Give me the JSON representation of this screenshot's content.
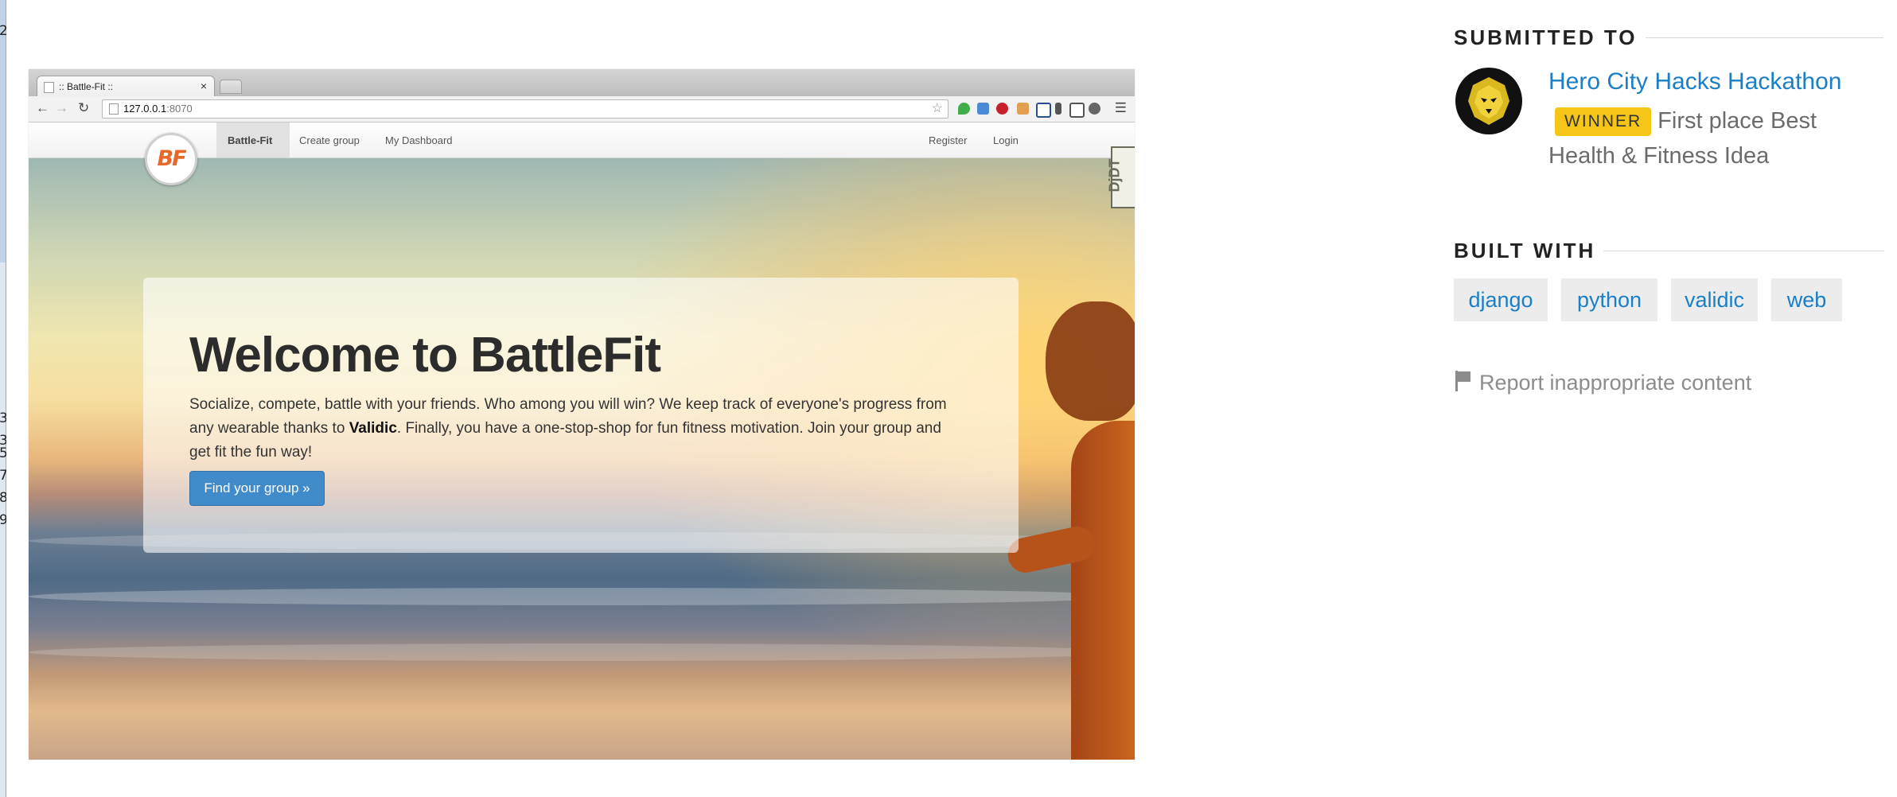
{
  "left_strip": {
    "glyphs": [
      "2",
      "3",
      "3",
      "5",
      "7",
      "8",
      "9"
    ]
  },
  "screenshot": {
    "browser": {
      "tab_title": ":: Battle-Fit ::",
      "tab_close": "×",
      "url_host": "127.0.0.1",
      "url_port": ":8070",
      "icons": [
        "back-icon",
        "forward-icon",
        "reload-icon",
        "page-icon",
        "bookmark-star-icon",
        "extension-icons",
        "chrome-menu-icon"
      ]
    },
    "site": {
      "logo": "BF",
      "nav": {
        "brand": "Battle-Fit",
        "create_group": "Create group",
        "dashboard": "My Dashboard",
        "register": "Register",
        "login": "Login"
      },
      "debug_toolbar": "DjDT",
      "hero": {
        "title": "Welcome to BattleFit",
        "text_before": "Socialize, compete, battle with your friends. Who among you will win? We keep track of everyone's progress from any wearable thanks to ",
        "text_bold": "Validic",
        "text_after": ". Finally, you have a one-stop-shop for fun fitness motivation. Join your group and get fit the fun way!",
        "button": "Find your group »"
      }
    }
  },
  "sidebar": {
    "submitted_to": {
      "heading": "SUBMITTED TO",
      "hackathon_name": "Hero City Hacks Hackathon",
      "badge": "WINNER",
      "prize": "First place Best Health & Fitness Idea",
      "logo_icon": "lion-icon"
    },
    "built_with": {
      "heading": "BUILT WITH",
      "tags": [
        "django",
        "python",
        "validic",
        "web"
      ]
    },
    "report": {
      "label": "Report inappropriate content",
      "icon": "flag-icon"
    }
  },
  "colors": {
    "link": "#1b7fc6",
    "badge": "#f5c518",
    "primary_button": "#428bca",
    "logo_orange": "#e8682a"
  }
}
